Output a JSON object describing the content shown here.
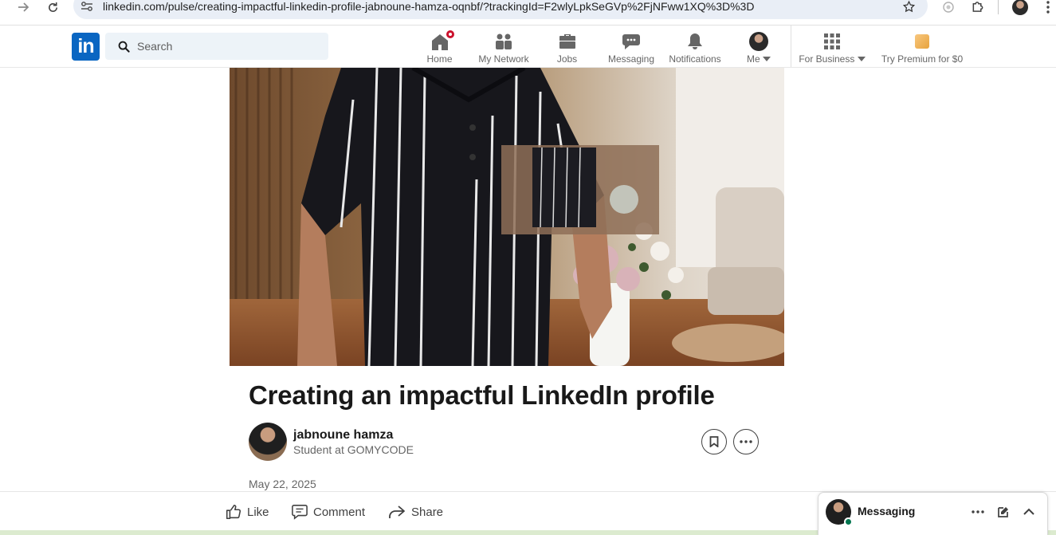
{
  "browser": {
    "url": "linkedin.com/pulse/creating-impactful-linkedin-profile-jabnoune-hamza-oqnbf/?trackingId=F2wlyLpkSeGVp%2FjNFww1XQ%3D%3D",
    "icons": [
      "forward-arrow-icon",
      "reload-icon",
      "site-settings-icon",
      "bookmark-star-icon",
      "extension-icon",
      "puzzle-icon",
      "profile-avatar",
      "kebab-menu-icon"
    ]
  },
  "header": {
    "logo_text": "in",
    "search_placeholder": "Search",
    "nav": [
      {
        "label": "Home",
        "icon": "home-icon",
        "has_badge": true
      },
      {
        "label": "My Network",
        "icon": "network-icon"
      },
      {
        "label": "Jobs",
        "icon": "briefcase-icon"
      },
      {
        "label": "Messaging",
        "icon": "chat-icon"
      },
      {
        "label": "Notifications",
        "icon": "bell-icon"
      },
      {
        "label": "Me",
        "icon": "avatar"
      },
      {
        "label": "For Business",
        "icon": "grid-icon"
      },
      {
        "label": "Try Premium for $0",
        "icon": "premium-icon"
      }
    ],
    "brand_color": "#0a66c2",
    "badge_color": "#cb112d"
  },
  "article": {
    "title": "Creating an impactful LinkedIn profile",
    "author": {
      "name": "jabnoune hamza",
      "headline": "Student at GOMYCODE"
    },
    "date": "May 22, 2025"
  },
  "actions": {
    "like": "Like",
    "comment": "Comment",
    "share": "Share"
  },
  "messaging": {
    "label": "Messaging",
    "online_color": "#01754f"
  }
}
